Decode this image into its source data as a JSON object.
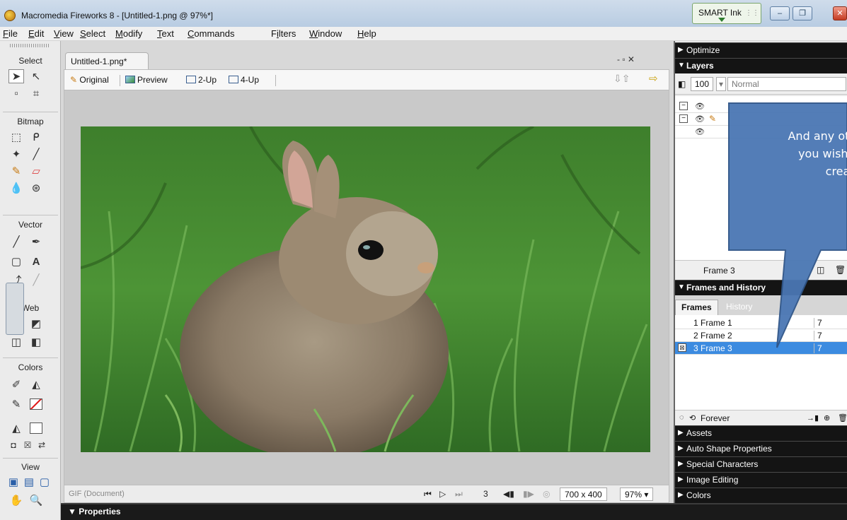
{
  "window": {
    "title": "Macromedia Fireworks 8 - [Untitled-1.png @ 97%*]",
    "smart_ink_label": "SMART Ink",
    "minimize": "–",
    "restore": "❐",
    "close": "✕"
  },
  "menu": {
    "items": [
      {
        "key": "F",
        "rest": "ile"
      },
      {
        "key": "E",
        "rest": "dit"
      },
      {
        "key": "V",
        "rest": "iew"
      },
      {
        "key": "S",
        "rest": "elect"
      },
      {
        "key": "M",
        "rest": "odify"
      },
      {
        "key": "T",
        "rest": "ext"
      },
      {
        "key": "C",
        "rest": "ommands"
      },
      {
        "pre": "F",
        "key": "i",
        "rest": "lters"
      },
      {
        "key": "W",
        "rest": "indow"
      },
      {
        "key": "H",
        "rest": "elp"
      }
    ]
  },
  "tools": {
    "sections": [
      "Select",
      "Bitmap",
      "Vector",
      "Web",
      "Colors",
      "View"
    ],
    "text_tool": "A"
  },
  "document": {
    "tab_label": "Untitled-1.png*",
    "window_controls": "- ▫ ✕",
    "views": [
      "Original",
      "Preview",
      "2-Up",
      "4-Up"
    ],
    "status_format": "GIF (Document)",
    "current_frame": "3",
    "canvas_size": "700 x 400",
    "zoom": "97%",
    "photo_description_icon": "rabbit-photo"
  },
  "properties": {
    "label": "▼ Properties"
  },
  "panels": {
    "optimize": "Optimize",
    "layers": "Layers",
    "opacity": "100",
    "blend_mode": "Normal",
    "layers_footer_frame": "Frame 3",
    "frames_history": "Frames and History",
    "frames_tab": "Frames",
    "history_tab": "History",
    "frames": [
      {
        "name": "1  Frame 1",
        "delay": "7"
      },
      {
        "name": "2  Frame 2",
        "delay": "7"
      },
      {
        "name": "3  Frame 3",
        "delay": "7"
      }
    ],
    "loop": "Forever",
    "collapsed": [
      "Assets",
      "Auto Shape Properties",
      "Special Characters",
      "Image Editing",
      "Colors"
    ]
  },
  "callout": {
    "line1": "And any oth",
    "line2": "you wish t",
    "line3": "crea",
    "color": "#4a77b4"
  },
  "colors": {
    "title_bar": "#c4d5e8",
    "panel_header": "#141414",
    "selection": "#3c8be0"
  }
}
